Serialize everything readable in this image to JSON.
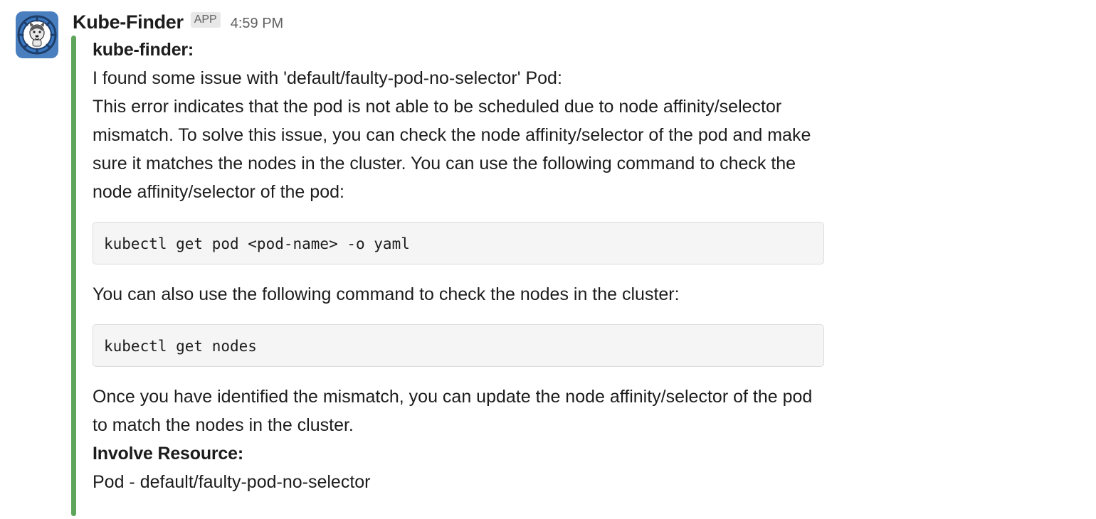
{
  "message": {
    "sender": "Kube-Finder",
    "badge": "APP",
    "timestamp": "4:59 PM",
    "avatar_icon": "husky-dog-helm-wheel-icon",
    "accent_color": "#5fa65c"
  },
  "attachment": {
    "heading": "kube-finder:",
    "intro": "I found some issue with 'default/faulty-pod-no-selector' Pod:",
    "paragraph1": "This error indicates that the pod is not able to be scheduled due to node affinity/selector mismatch. To solve this issue, you can check the node affinity/selector of the pod and make sure it matches the nodes in the cluster. You can use the following command to check the node affinity/selector of the pod:",
    "code1": "kubectl get pod <pod-name> -o yaml",
    "paragraph2": "You can also use the following command to check the nodes in the cluster:",
    "code2": "kubectl get nodes",
    "paragraph3": "Once you have identified the mismatch, you can update the node affinity/selector of the pod to match the nodes in the cluster.",
    "resource_label": "Involve Resource:",
    "resource_value": "Pod - default/faulty-pod-no-selector"
  }
}
